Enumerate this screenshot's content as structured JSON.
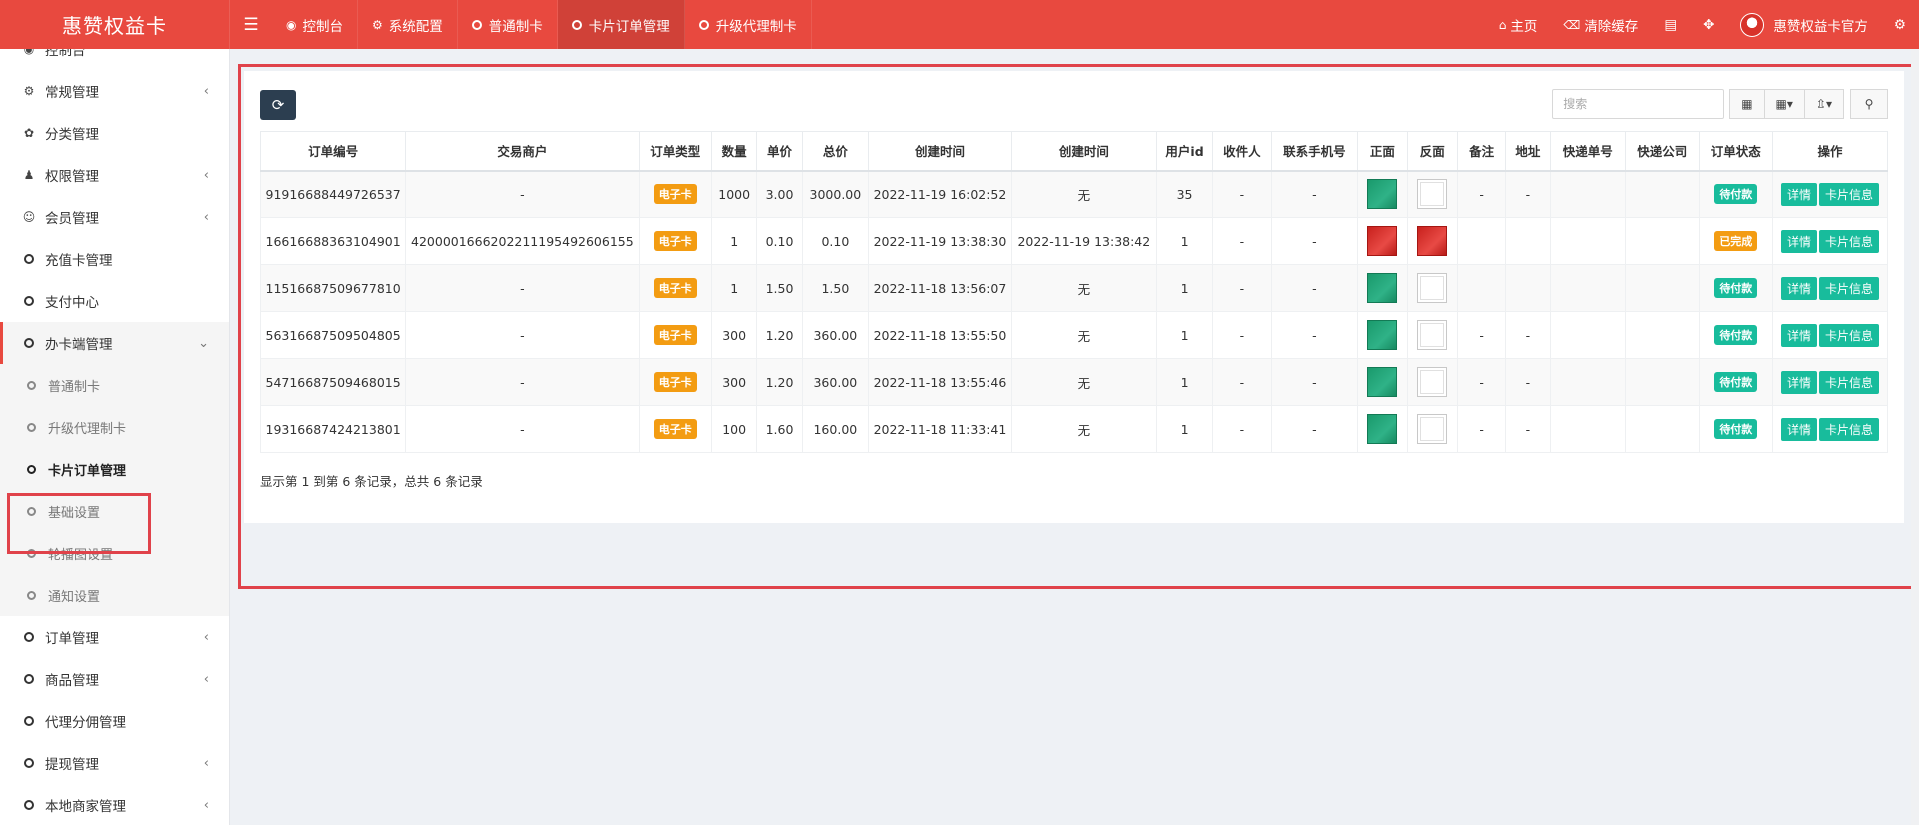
{
  "app": {
    "title": "惠赞权益卡"
  },
  "topnav": {
    "items": [
      {
        "label": "控制台",
        "icon": "dashboard-icon"
      },
      {
        "label": "系统配置",
        "icon": "gear-icon"
      },
      {
        "label": "普通制卡",
        "icon": "circle-icon"
      },
      {
        "label": "卡片订单管理",
        "icon": "circle-icon"
      },
      {
        "label": "升级代理制卡",
        "icon": "circle-icon"
      }
    ],
    "right": {
      "home": "主页",
      "clear_cache": "清除缓存",
      "user": "惠赞权益卡官方"
    }
  },
  "sidebar": {
    "items": [
      {
        "label": "控制台"
      },
      {
        "label": "常规管理"
      },
      {
        "label": "分类管理"
      },
      {
        "label": "权限管理"
      },
      {
        "label": "会员管理"
      },
      {
        "label": "充值卡管理"
      },
      {
        "label": "支付中心"
      },
      {
        "label": "办卡端管理"
      },
      {
        "label": "普通制卡"
      },
      {
        "label": "升级代理制卡"
      },
      {
        "label": "卡片订单管理"
      },
      {
        "label": "基础设置"
      },
      {
        "label": "轮播图设置"
      },
      {
        "label": "通知设置"
      },
      {
        "label": "订单管理"
      },
      {
        "label": "商品管理"
      },
      {
        "label": "代理分佣管理"
      },
      {
        "label": "提现管理"
      },
      {
        "label": "本地商家管理"
      }
    ]
  },
  "toolbar": {
    "search_placeholder": "搜索"
  },
  "table": {
    "headers": [
      "订单编号",
      "交易商户",
      "订单类型",
      "数量",
      "单价",
      "总价",
      "创建时间",
      "创建时间",
      "用户id",
      "收件人",
      "联系手机号",
      "正面",
      "反面",
      "备注",
      "地址",
      "快递单号",
      "快递公司",
      "订单状态",
      "操作"
    ],
    "detail_label": "详情",
    "card_info_label": "卡片信息",
    "rows": [
      {
        "order_no": "91916688449726537",
        "merchant": "-",
        "type": "电子卡",
        "qty": "1000",
        "unit_price": "3.00",
        "total": "3000.00",
        "created": "2022-11-19 16:02:52",
        "created2": "无",
        "user_id": "35",
        "recipient": "-",
        "phone": "-",
        "front": "green",
        "back": "broken",
        "remark": "-",
        "address": "-",
        "express_no": "",
        "express_co": "",
        "status": "待付款",
        "status_color": "green"
      },
      {
        "order_no": "16616688363104901",
        "merchant": "420000166620221119549260615​5",
        "type": "电子卡",
        "qty": "1",
        "unit_price": "0.10",
        "total": "0.10",
        "created": "2022-11-19 13:38:30",
        "created2": "2022-11-19 13:38:42",
        "user_id": "1",
        "recipient": "-",
        "phone": "-",
        "front": "red",
        "back": "red",
        "remark": "",
        "address": "",
        "express_no": "",
        "express_co": "",
        "status": "已完成",
        "status_color": "orange"
      },
      {
        "order_no": "11516687509677810",
        "merchant": "-",
        "type": "电子卡",
        "qty": "1",
        "unit_price": "1.50",
        "total": "1.50",
        "created": "2022-11-18 13:56:07",
        "created2": "无",
        "user_id": "1",
        "recipient": "-",
        "phone": "-",
        "front": "green",
        "back": "broken",
        "remark": "",
        "address": "",
        "express_no": "",
        "express_co": "",
        "status": "待付款",
        "status_color": "green"
      },
      {
        "order_no": "56316687509504805",
        "merchant": "-",
        "type": "电子卡",
        "qty": "300",
        "unit_price": "1.20",
        "total": "360.00",
        "created": "2022-11-18 13:55:50",
        "created2": "无",
        "user_id": "1",
        "recipient": "-",
        "phone": "-",
        "front": "green",
        "back": "broken",
        "remark": "-",
        "address": "-",
        "express_no": "",
        "express_co": "",
        "status": "待付款",
        "status_color": "green"
      },
      {
        "order_no": "54716687509468015",
        "merchant": "-",
        "type": "电子卡",
        "qty": "300",
        "unit_price": "1.20",
        "total": "360.00",
        "created": "2022-11-18 13:55:46",
        "created2": "无",
        "user_id": "1",
        "recipient": "-",
        "phone": "-",
        "front": "green",
        "back": "broken",
        "remark": "-",
        "address": "-",
        "express_no": "",
        "express_co": "",
        "status": "待付款",
        "status_color": "green"
      },
      {
        "order_no": "19316687424213801",
        "merchant": "-",
        "type": "电子卡",
        "qty": "100",
        "unit_price": "1.60",
        "total": "160.00",
        "created": "2022-11-18 11:33:41",
        "created2": "无",
        "user_id": "1",
        "recipient": "-",
        "phone": "-",
        "front": "green",
        "back": "broken",
        "remark": "-",
        "address": "-",
        "express_no": "",
        "express_co": "",
        "status": "待付款",
        "status_color": "green"
      }
    ]
  },
  "footer": {
    "summary": "显示第 1 到第 6 条记录，总共 6 条记录"
  }
}
